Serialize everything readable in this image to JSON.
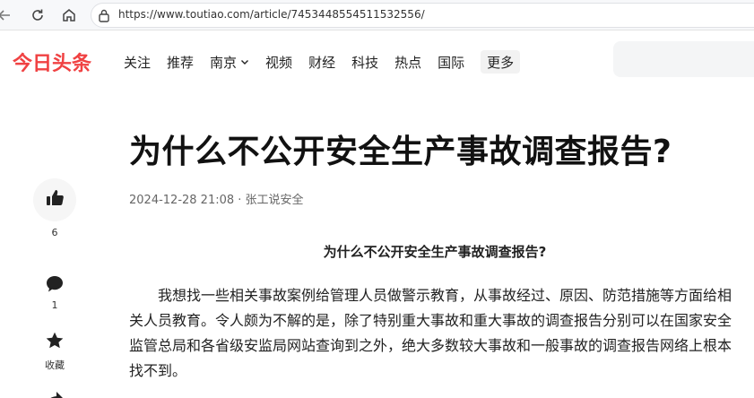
{
  "browser": {
    "url": "https://www.toutiao.com/article/7453448554511532556/",
    "icons": [
      "back-icon",
      "reload-icon",
      "home-icon",
      "lock-icon"
    ]
  },
  "site": {
    "logo": "今日头条",
    "nav": [
      "关注",
      "推荐",
      "南京",
      "视频",
      "财经",
      "科技",
      "热点",
      "国际"
    ],
    "more": "更多"
  },
  "actions": {
    "like_count": "6",
    "comment_count": "1",
    "favorite_label": "收藏"
  },
  "article": {
    "title": "为什么不公开安全生产事故调查报告?",
    "meta": "2024-12-28 21:08 · 张工说安全",
    "subtitle": "为什么不公开安全生产事故调查报告?",
    "paragraph": "我想找一些相关事故案例给管理人员做警示教育，从事故经过、原因、防范措施等方面给相关人员教育。令人颇为不解的是，除了特别重大事故和重大事故的调查报告分别可以在国家安全监管总局和各省级安监局网站查询到之外，绝大多数较大事故和一般事故的调查报告网络上根本找不到。"
  },
  "colors": {
    "brand": "#f04142",
    "text": "#222222",
    "muted": "#666666"
  }
}
